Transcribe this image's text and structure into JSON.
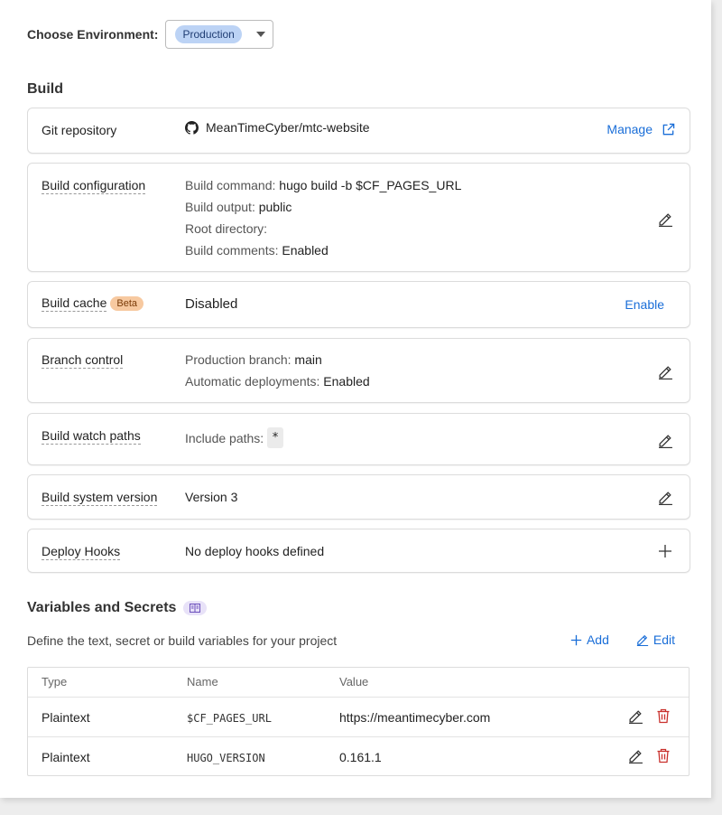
{
  "environment": {
    "label": "Choose Environment:",
    "selected": "Production"
  },
  "build": {
    "section_title": "Build",
    "git": {
      "label": "Git repository",
      "repo": "MeanTimeCyber/mtc-website",
      "manage_label": "Manage"
    },
    "config": {
      "label": "Build configuration",
      "lines": [
        {
          "key": "Build command:",
          "value": "hugo build -b $CF_PAGES_URL"
        },
        {
          "key": "Build output:",
          "value": "public"
        },
        {
          "key": "Root directory:",
          "value": ""
        },
        {
          "key": "Build comments:",
          "value": "Enabled"
        }
      ]
    },
    "cache": {
      "label": "Build cache",
      "badge": "Beta",
      "status": "Disabled",
      "action_label": "Enable"
    },
    "branch": {
      "label": "Branch control",
      "lines": [
        {
          "key": "Production branch:",
          "value": "main"
        },
        {
          "key": "Automatic deployments:",
          "value": "Enabled"
        }
      ]
    },
    "watch": {
      "label": "Build watch paths",
      "key": "Include paths:",
      "value": "*"
    },
    "system": {
      "label": "Build system version",
      "value": "Version 3"
    },
    "hooks": {
      "label": "Deploy Hooks",
      "value": "No deploy hooks defined"
    }
  },
  "variables": {
    "title": "Variables and Secrets",
    "description": "Define the text, secret or build variables for your project",
    "add_label": "Add",
    "edit_label": "Edit",
    "columns": [
      "Type",
      "Name",
      "Value"
    ],
    "rows": [
      {
        "type": "Plaintext",
        "name": "$CF_PAGES_URL",
        "value": "https://meantimecyber.com"
      },
      {
        "type": "Plaintext",
        "name": "HUGO_VERSION",
        "value": "0.161.1"
      }
    ]
  },
  "colors": {
    "link": "#1a6ed8",
    "delete": "#c9302c",
    "env_pill": "#bcd3f5",
    "beta_badge": "#f7c9a0"
  }
}
